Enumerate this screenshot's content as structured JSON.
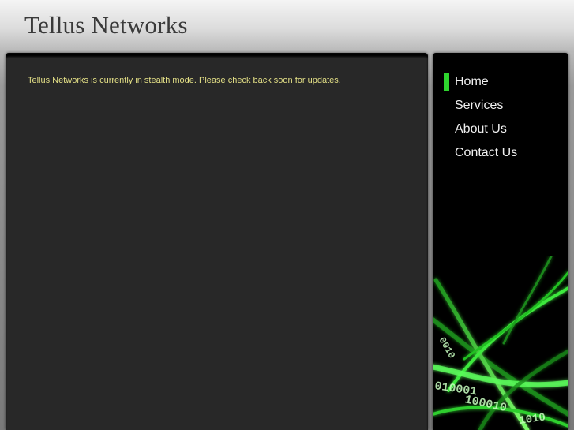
{
  "header": {
    "title": "Tellus Networks"
  },
  "main": {
    "message": "Tellus Networks is currently in stealth mode. Please check back soon for updates."
  },
  "sidebar": {
    "items": [
      {
        "label": "Home",
        "active": true
      },
      {
        "label": "Services",
        "active": false
      },
      {
        "label": "About Us",
        "active": false
      },
      {
        "label": "Contact Us",
        "active": false
      }
    ],
    "art_digits": [
      "010001",
      "100010",
      "0010",
      "1010"
    ]
  },
  "colors": {
    "accent": "#2ed42e",
    "message_text": "#e3df86",
    "panel_bg": "#282828",
    "sidebar_bg": "#000000",
    "title_text": "#3a3a3a"
  }
}
